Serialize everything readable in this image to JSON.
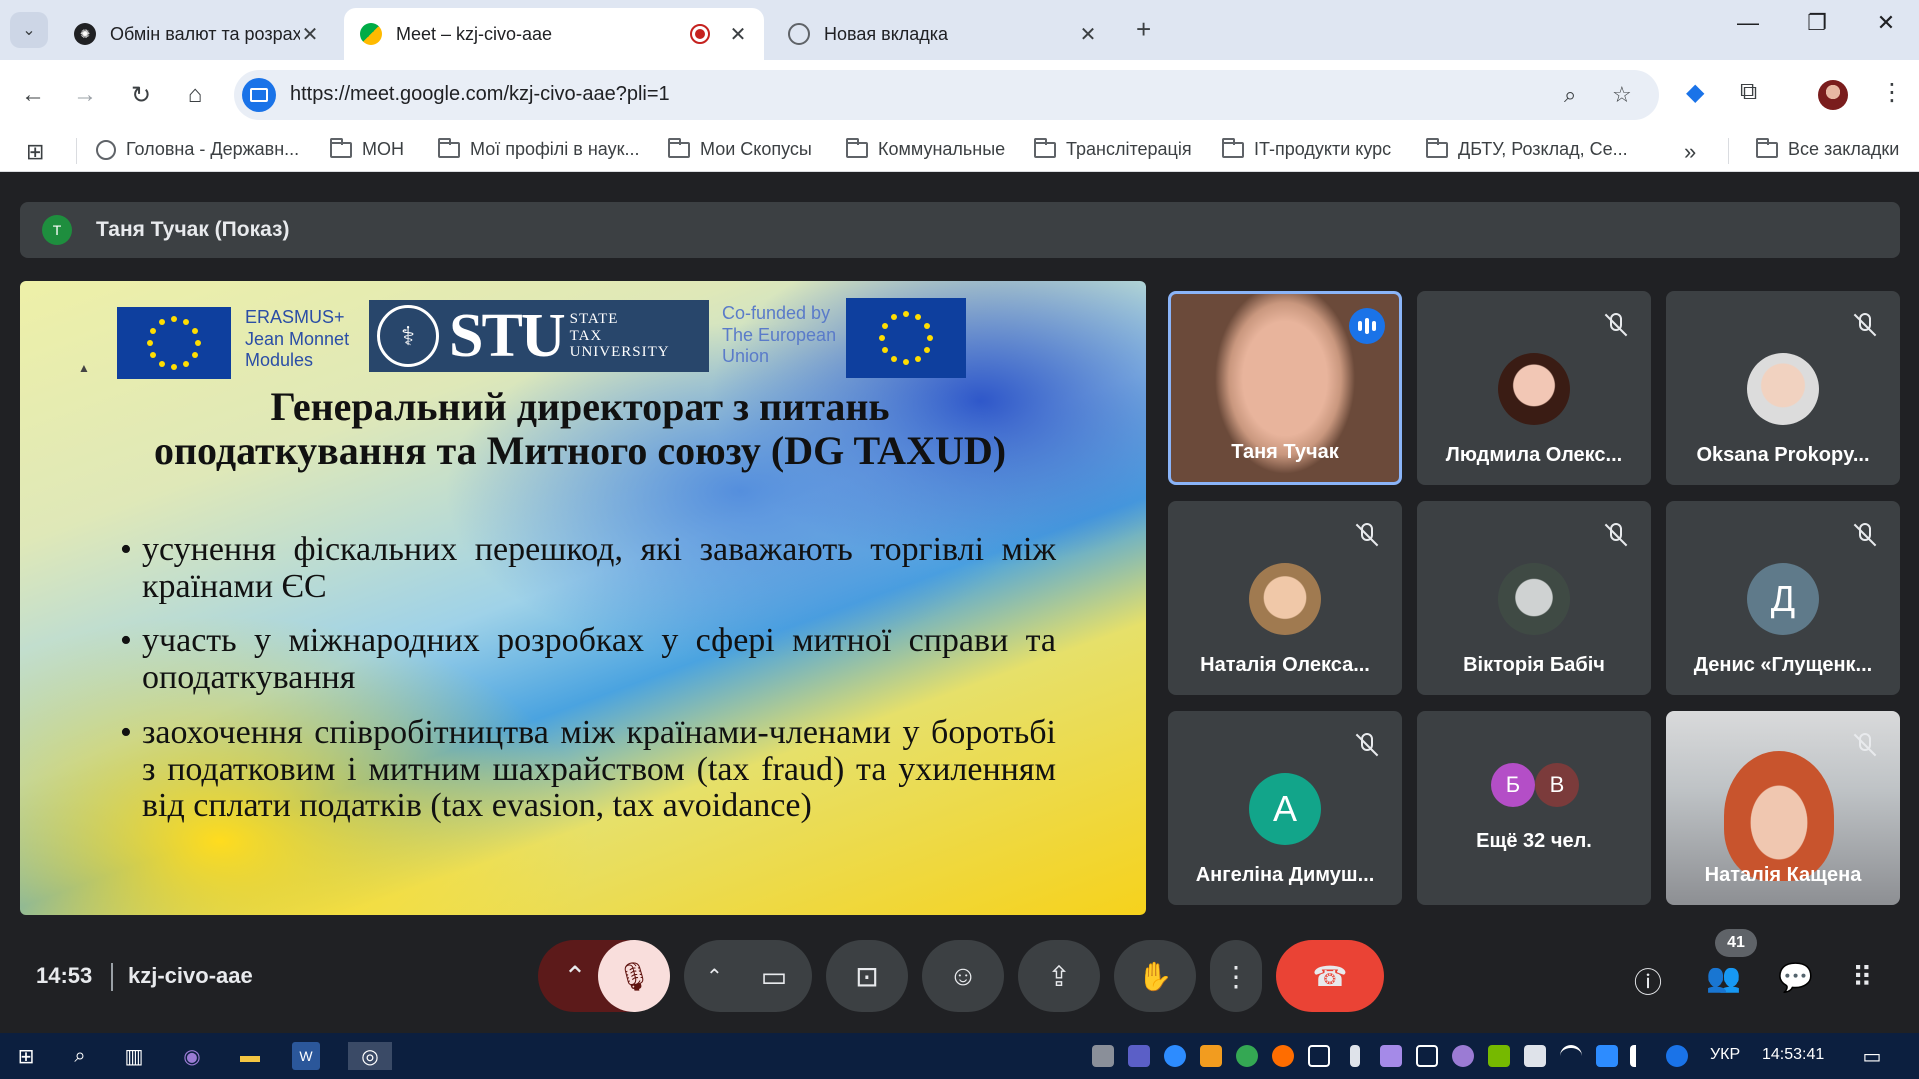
{
  "browser": {
    "tabs": [
      {
        "title": "Обмін валют та розрахунок",
        "active": false
      },
      {
        "title": "Meet – kzj-civo-aae",
        "active": true
      },
      {
        "title": "Новая вкладка",
        "active": false
      }
    ],
    "url": "https://meet.google.com/kzj-civo-aae?pli=1",
    "bookmarks": [
      "Головна - Державн...",
      "МОН",
      "Мої профілі в наук...",
      "Мои Скопусы",
      "Коммунальные",
      "Транслітерація",
      "IT-продукти курс",
      "ДБТУ, Розклад, Се..."
    ],
    "all_bookmarks": "Все закладки"
  },
  "meet": {
    "presenter": {
      "initial": "T",
      "label": "Таня Тучак (Показ)"
    },
    "slide": {
      "logo_left_lines": [
        "ERASMUS+",
        "Jean Monnet",
        "Modules"
      ],
      "stu_big": "STU",
      "stu_small_lines": [
        "STATE",
        "TAX",
        "UNIVERSITY"
      ],
      "cofunded_lines": [
        "Co-funded by",
        "The European",
        "Union"
      ],
      "title": "Генеральний директорат з питань оподаткування та Митного союзу (DG TAXUD)",
      "bullets": [
        "усунення фіскальних перешкод, які заважають торгівлі між країнами ЄС",
        "участь у міжнародних розробках у сфері митної справи та оподаткування",
        "заохочення співробітництва між країнами-членами у боротьбі з податковим і митним шахрайством (tax fraud) та ухиленням від сплати податків (tax evasion, tax avoidance)"
      ]
    },
    "participants": [
      {
        "name": "Таня Тучак",
        "speaking": true
      },
      {
        "name": "Людмила Олекс...",
        "muted": true
      },
      {
        "name": "Oksana Prokopy...",
        "muted": true
      },
      {
        "name": "Наталія Олекса...",
        "muted": true
      },
      {
        "name": "Вікторія Бабіч",
        "muted": true
      },
      {
        "name": "Денис «Глущенк...",
        "muted": true,
        "initial": "Д",
        "color": "#5f7a8a"
      },
      {
        "name": "Ангеліна Димуш...",
        "muted": true,
        "initial": "A",
        "color": "#12a58a"
      },
      {
        "name": "Ещё 32 чел.",
        "initials": [
          "Б",
          "В"
        ]
      },
      {
        "name": "Наталія Кащена",
        "muted": true
      }
    ],
    "time": "14:53",
    "meeting_code": "kzj-civo-aae",
    "participant_count": "41"
  },
  "taskbar": {
    "language": "УКР",
    "time": "14:53:41"
  },
  "colors": {
    "end_call": "#ea4335",
    "mic_off": "#f9dedc",
    "accent": "#1a73e8"
  }
}
